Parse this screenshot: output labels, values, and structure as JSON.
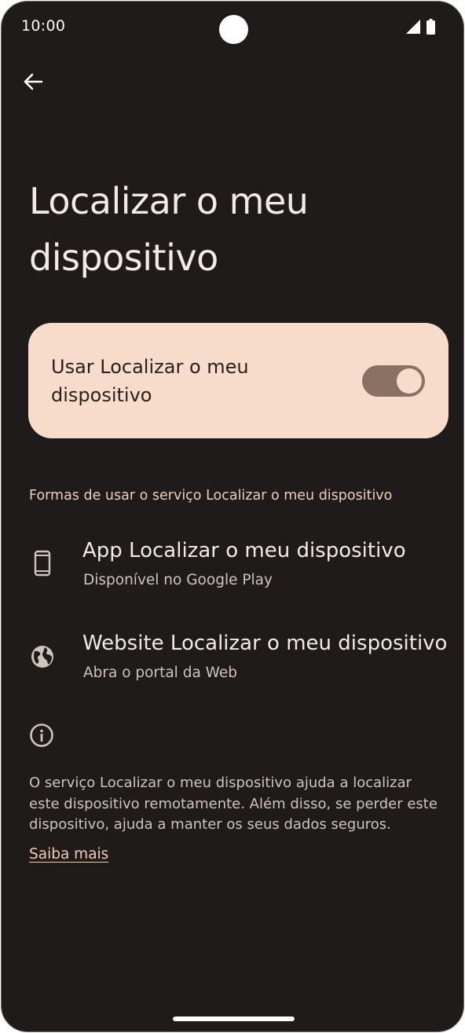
{
  "status_bar": {
    "time": "10:00",
    "icons": [
      "cellular-signal-icon",
      "battery-icon"
    ]
  },
  "nav": {
    "back_icon": "arrow-back-icon"
  },
  "page": {
    "title": "Localizar o meu dispositivo"
  },
  "main_toggle": {
    "label": "Usar Localizar o meu dispositivo",
    "state": "on"
  },
  "section": {
    "header": "Formas de usar o serviço Localizar o meu dispositivo",
    "items": [
      {
        "icon": "smartphone-icon",
        "title": "App Localizar o meu dispositivo",
        "subtitle": "Disponível no Google Play"
      },
      {
        "icon": "globe-icon",
        "title": "Website Localizar o meu dispositivo",
        "subtitle": "Abra o portal da Web"
      }
    ]
  },
  "footer": {
    "icon": "info-icon",
    "text": "O serviço Localizar o meu dispositivo ajuda a localizar este dispositivo remotamente. Além disso, se perder este dispositivo, ajuda a manter os seus dados seguros.",
    "link": "Saiba mais"
  },
  "colors": {
    "background": "#1e1b1a",
    "card": "#f8dccb",
    "accent": "#f2cdb6",
    "switch_track": "#8a7262"
  }
}
